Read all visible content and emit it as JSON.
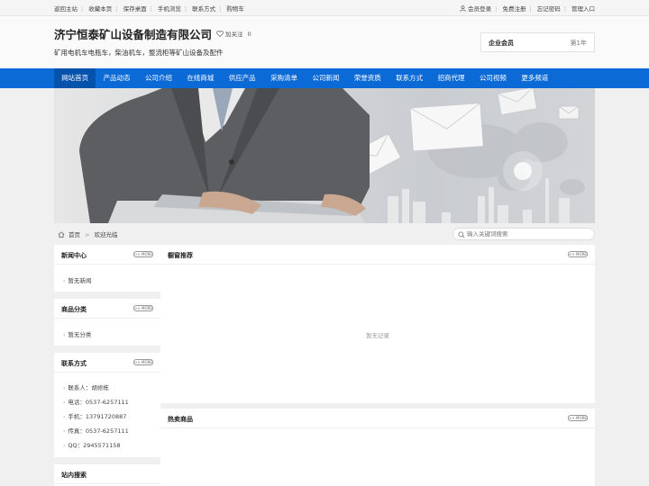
{
  "topbar": {
    "left_links": [
      "返回主站",
      "收藏本页",
      "保存桌面",
      "手机浏览",
      "联系方式",
      "购物车"
    ],
    "right_links": [
      "会员登录",
      "免费注册",
      "忘记密码",
      "管理入口"
    ]
  },
  "header": {
    "company_name": "济宁恒泰矿山设备制造有限公司",
    "follow_label": "加关注",
    "follow_count": "0",
    "tagline": "矿用电机车电瓶车，柴油机车，整流柜等矿山设备及配件",
    "member_label": "企业会员",
    "member_year": "第1年"
  },
  "nav": {
    "items": [
      "网站首页",
      "产品动态",
      "公司介绍",
      "在线商城",
      "供应产品",
      "采购清单",
      "公司新闻",
      "荣誉资质",
      "联系方式",
      "招商代理",
      "公司视频",
      "更多频道"
    ]
  },
  "breadcrumb": {
    "home": "首页",
    "current": "欢迎光临"
  },
  "search": {
    "placeholder": "输入关键词搜索"
  },
  "more_label": ">> MORE",
  "sidebar": {
    "news": {
      "title": "新闻中心",
      "empty": "暂无新闻"
    },
    "categories": {
      "title": "商品分类",
      "empty": "暂无分类"
    },
    "contact": {
      "title": "联系方式",
      "lines": [
        "联系人：胡修栋",
        "电话：0537-6257111",
        "手机：13791720887",
        "传真：0537-6257111",
        "QQ：2945571158"
      ]
    },
    "site_search": {
      "title": "站内搜索"
    }
  },
  "main": {
    "showcase": {
      "title": "橱窗推荐",
      "empty": "暂无记录"
    },
    "hot": {
      "title": "热卖商品"
    }
  },
  "colors": {
    "nav_bg": "#0b6ad6",
    "nav_active": "#0552ad"
  }
}
